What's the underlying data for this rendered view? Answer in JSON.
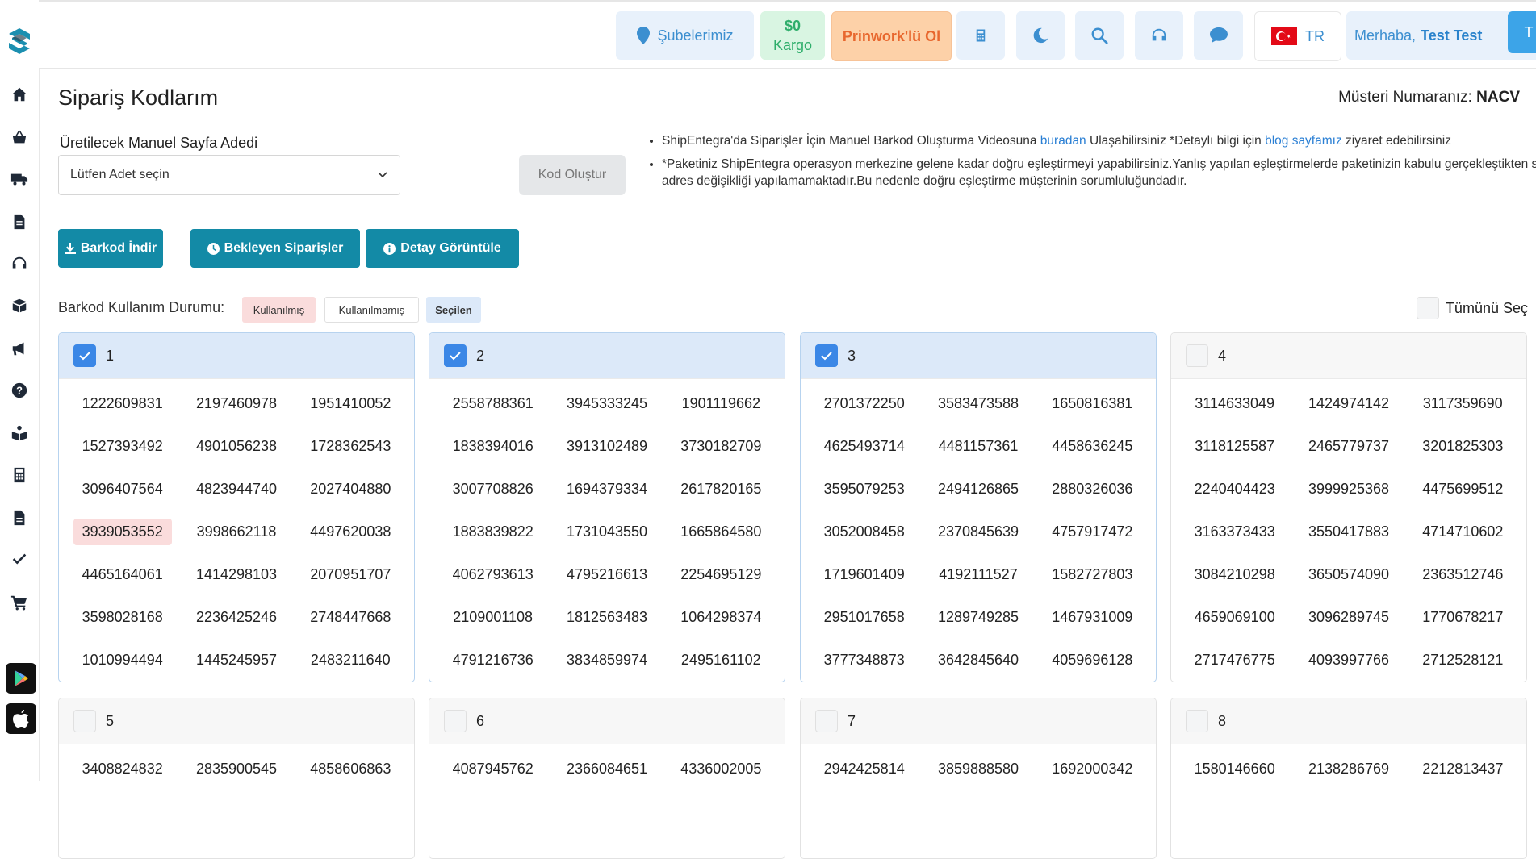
{
  "topbar": {
    "branches": "Şubelerimiz",
    "cargo_amount": "$0",
    "cargo_label": "Kargo",
    "prinwork": "Prinwork'lü Ol",
    "lang": "TR",
    "greeting": "Merhaba,",
    "user_name": "Test Test",
    "avatar": "T"
  },
  "page": {
    "title": "Sipariş Kodlarım",
    "customer_label": "Müsteri Numaranız:",
    "customer_no": "NACV"
  },
  "form": {
    "label": "Üretilecek Manuel Sayfa Adedi",
    "select_value": "Lütfen Adet seçin",
    "generate": "Kod Oluştur"
  },
  "info": {
    "l1_a": "ShipEntegra'da Siparişler İçin Manuel Barkod Oluşturma Videosuna ",
    "l1_link1": "buradan",
    "l1_b": " Ulaşabilirsiniz *Detaylı bilgi için ",
    "l1_link2": "blog sayfamız",
    "l1_c": " ziyaret edebilirsiniz",
    "l2": "*Paketiniz ShipEntegra operasyon merkezine gelene kadar doğru eşleştirmeyi yapabilirsiniz.Yanlış yapılan eşleştirmelerde paketinizin kabulu gerçekleştikten sonra adres değişikliği yapılamamaktadır.Bu nedenle doğru eşleştirme müşterinin sorumluluğundadır."
  },
  "actions": {
    "download": "Barkod İndir",
    "pending": "Bekleyen Siparişler",
    "detail": "Detay Görüntüle"
  },
  "legend": {
    "label": "Barkod Kullanım Durumu:",
    "used": "Kullanılmış",
    "unused": "Kullanılmamış",
    "selected": "Seçilen",
    "select_all": "Tümünü Seç"
  },
  "colors": {
    "primary": "#138aa6",
    "checkbox": "#3b87e6",
    "used_bg": "#fadcdc",
    "selected_bg": "#dce9f9"
  },
  "pages": [
    {
      "num": "1",
      "checked": true,
      "codes": [
        "1222609831",
        "2197460978",
        "1951410052",
        "1527393492",
        "4901056238",
        "1728362543",
        "3096407564",
        "4823944740",
        "2027404880",
        "3939053552",
        "3998662118",
        "4497620038",
        "4465164061",
        "1414298103",
        "2070951707",
        "3598028168",
        "2236425246",
        "2748447668",
        "1010994494",
        "1445245957",
        "2483211640"
      ],
      "used": [
        9
      ]
    },
    {
      "num": "2",
      "checked": true,
      "codes": [
        "2558788361",
        "3945333245",
        "1901119662",
        "1838394016",
        "3913102489",
        "3730182709",
        "3007708826",
        "1694379334",
        "2617820165",
        "1883839822",
        "1731043550",
        "1665864580",
        "4062793613",
        "4795216613",
        "2254695129",
        "2109001108",
        "1812563483",
        "1064298374",
        "4791216736",
        "3834859974",
        "2495161102"
      ],
      "used": []
    },
    {
      "num": "3",
      "checked": true,
      "codes": [
        "2701372250",
        "3583473588",
        "1650816381",
        "4625493714",
        "4481157361",
        "4458636245",
        "3595079253",
        "2494126865",
        "2880326036",
        "3052008458",
        "2370845639",
        "4757917472",
        "1719601409",
        "4192111527",
        "1582727803",
        "2951017658",
        "1289749285",
        "1467931009",
        "3777348873",
        "3642845640",
        "4059696128"
      ],
      "used": []
    },
    {
      "num": "4",
      "checked": false,
      "codes": [
        "3114633049",
        "1424974142",
        "3117359690",
        "3118125587",
        "2465779737",
        "3201825303",
        "2240404423",
        "3999925368",
        "4475699512",
        "3163373433",
        "3550417883",
        "4714710602",
        "3084210298",
        "3650574090",
        "2363512746",
        "4659069100",
        "3096289745",
        "1770678217",
        "2717476775",
        "4093997766",
        "2712528121"
      ],
      "used": []
    },
    {
      "num": "5",
      "checked": false,
      "codes": [
        "3408824832",
        "2835900545",
        "4858606863"
      ],
      "used": []
    },
    {
      "num": "6",
      "checked": false,
      "codes": [
        "4087945762",
        "2366084651",
        "4336002005"
      ],
      "used": []
    },
    {
      "num": "7",
      "checked": false,
      "codes": [
        "2942425814",
        "3859888580",
        "1692000342"
      ],
      "used": []
    },
    {
      "num": "8",
      "checked": false,
      "codes": [
        "1580146660",
        "2138286769",
        "2212813437"
      ],
      "used": []
    }
  ]
}
